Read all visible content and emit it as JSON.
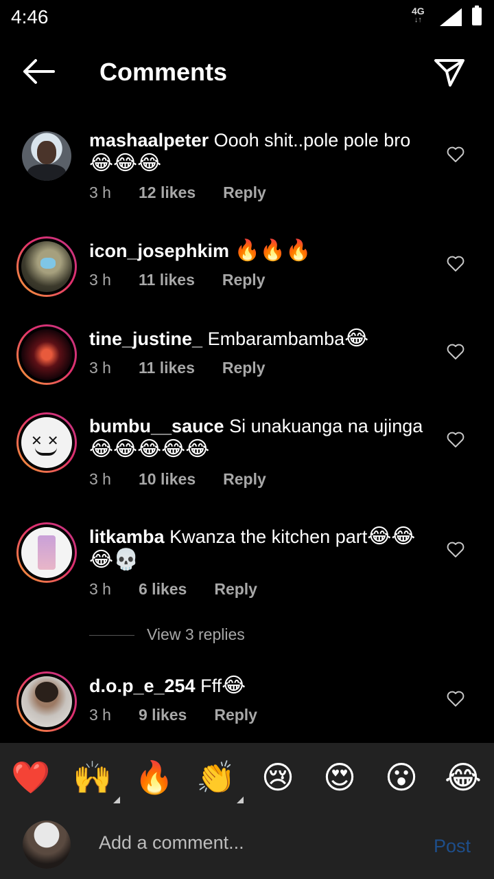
{
  "status_bar": {
    "time": "4:46",
    "network": "4G",
    "arrows": "↓↑"
  },
  "header": {
    "title": "Comments"
  },
  "comments": [
    {
      "user": "mashaalpeter",
      "text": "Oooh shit..pole pole bro",
      "emoji": "😂😂😂",
      "time": "3 h",
      "likes": "12 likes",
      "reply": "Reply"
    },
    {
      "user": "icon_josephkim",
      "text": "",
      "emoji": "🔥🔥🔥",
      "time": "3 h",
      "likes": "11 likes",
      "reply": "Reply"
    },
    {
      "user": "tine_justine_",
      "text": "Embarambamba",
      "emoji": "😂",
      "time": "3 h",
      "likes": "11 likes",
      "reply": "Reply"
    },
    {
      "user": "bumbu__sauce",
      "text": "Si unakuanga na ujinga",
      "emoji": "😂😂😂😂😂",
      "time": "3 h",
      "likes": "10 likes",
      "reply": "Reply"
    },
    {
      "user": "litkamba",
      "text": "Kwanza the kitchen part",
      "emoji": "😂😂😂💀",
      "time": "3 h",
      "likes": "6 likes",
      "reply": "Reply"
    },
    {
      "user": "d.o.p_e_254",
      "text": "Fff",
      "emoji": "😂",
      "time": "3 h",
      "likes": "9 likes",
      "reply": "Reply"
    }
  ],
  "view_replies": "View 3 replies",
  "emoji_bar": [
    "❤️",
    "🙌",
    "🔥",
    "👏",
    "😢",
    "😍",
    "😮",
    "😂"
  ],
  "composer": {
    "placeholder": "Add a comment...",
    "post_label": "Post"
  }
}
